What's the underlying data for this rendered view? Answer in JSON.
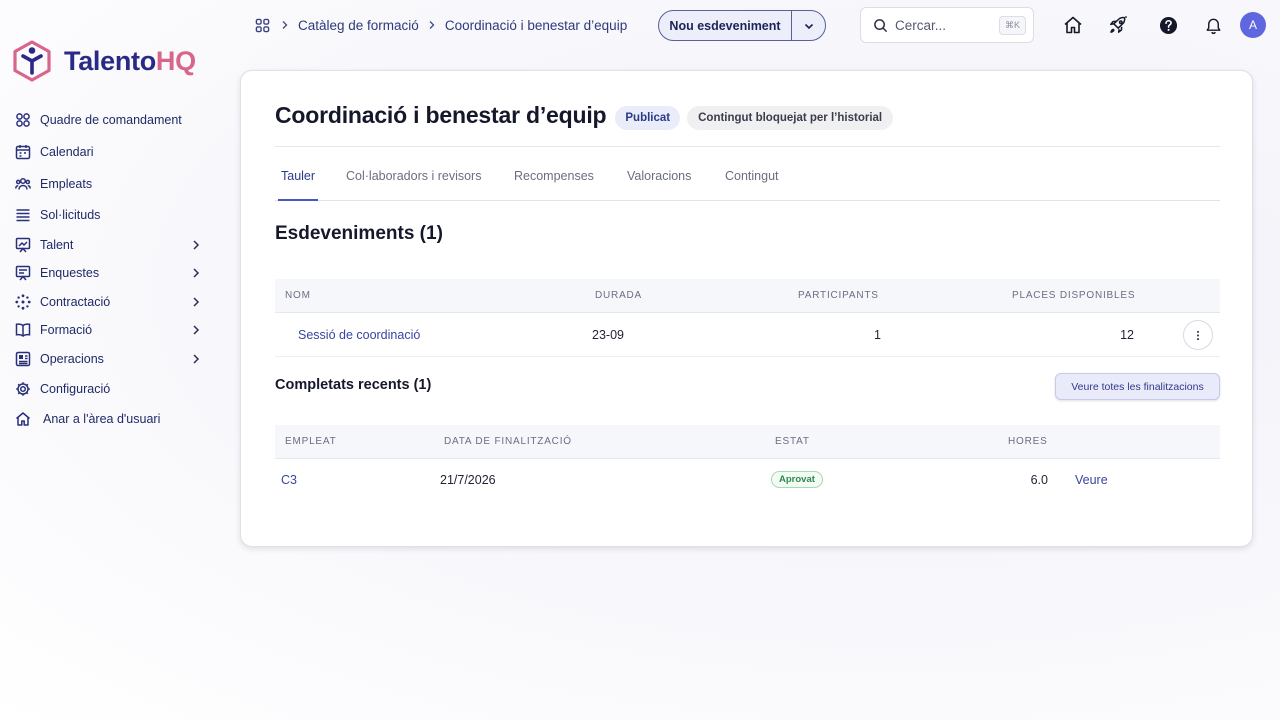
{
  "brand": {
    "name_part1": "Talento",
    "name_part2": "HQ",
    "color_primary": "#2a2a86",
    "color_accent": "#d8658a"
  },
  "sidebar": {
    "items": [
      {
        "label": "Quadre de comandament",
        "icon": "grid-icon",
        "has_children": false
      },
      {
        "label": "Calendari",
        "icon": "calendar-icon",
        "has_children": false
      },
      {
        "label": "Empleats",
        "icon": "users-icon",
        "has_children": false
      },
      {
        "label": "Sol·licituds",
        "icon": "list-icon",
        "has_children": false
      },
      {
        "label": "Talent",
        "icon": "presentation-icon",
        "has_children": true
      },
      {
        "label": "Enquestes",
        "icon": "survey-icon",
        "has_children": true
      },
      {
        "label": "Contractació",
        "icon": "dotted-circle-icon",
        "has_children": true
      },
      {
        "label": "Formació",
        "icon": "book-icon",
        "has_children": true
      },
      {
        "label": "Operacions",
        "icon": "document-icon",
        "has_children": true
      },
      {
        "label": "Configuració",
        "icon": "gear-icon",
        "has_children": false
      },
      {
        "label": "Anar a l'àrea d'usuari",
        "icon": "home-icon",
        "has_children": false
      }
    ]
  },
  "breadcrumb": {
    "items": [
      "Catàleg de formació",
      "Coordinació i benestar d’equip"
    ]
  },
  "header": {
    "new_event_label": "Nou esdeveniment",
    "search_placeholder": "Cercar...",
    "search_shortcut": "⌘K",
    "avatar_initial": "A"
  },
  "page": {
    "title": "Coordinació i benestar d’equip",
    "badge_status": "Publicat",
    "badge_lock": "Contingut bloquejat per l’historial",
    "tabs": [
      "Tauler",
      "Col·laboradors i revisors",
      "Recompenses",
      "Valoracions",
      "Contingut"
    ],
    "active_tab": "Tauler"
  },
  "events": {
    "title": "Esdeveniments (1)",
    "columns": [
      "NOM",
      "DURADA",
      "PARTICIPANTS",
      "PLACES DISPONIBLES"
    ],
    "rows": [
      {
        "name": "Sessió de coordinació",
        "duration": "23-09",
        "participants": "1",
        "available": "12"
      }
    ]
  },
  "completions": {
    "title": "Completats recents (1)",
    "view_all_label": "Veure totes les finalitzacions",
    "columns": [
      "EMPLEAT",
      "DATA DE FINALITZACIÓ",
      "ESTAT",
      "HORES"
    ],
    "rows": [
      {
        "employee": "C3",
        "date": "21/7/2026",
        "status": "Aprovat",
        "hours": "6.0",
        "action": "Veure"
      }
    ]
  }
}
